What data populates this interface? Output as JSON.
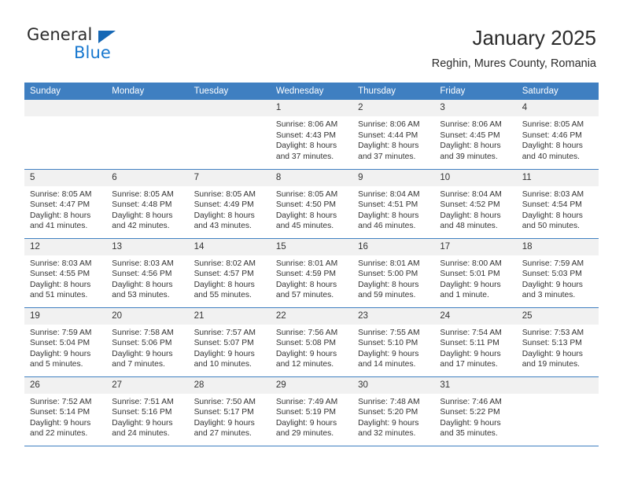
{
  "brand": {
    "name_top": "General",
    "name_bottom": "Blue",
    "accent_color": "#1878cf",
    "triangle_color": "#1567b5"
  },
  "header": {
    "title": "January 2025",
    "subtitle": "Reghin, Mures County, Romania"
  },
  "theme": {
    "header_row_bg": "#3f7fc1",
    "header_row_text": "#ffffff",
    "daynum_bg": "#f1f1f1",
    "grid_line": "#3f7fc1",
    "body_text": "#333333"
  },
  "weekdays": [
    "Sunday",
    "Monday",
    "Tuesday",
    "Wednesday",
    "Thursday",
    "Friday",
    "Saturday"
  ],
  "labels": {
    "sunrise_prefix": "Sunrise:",
    "sunset_prefix": "Sunset:",
    "daylight_prefix": "Daylight:"
  },
  "weeks": [
    [
      {
        "day": "",
        "blank": true,
        "l1": "",
        "l2": "",
        "l3": "",
        "l4": ""
      },
      {
        "day": "",
        "blank": true,
        "l1": "",
        "l2": "",
        "l3": "",
        "l4": ""
      },
      {
        "day": "",
        "blank": true,
        "l1": "",
        "l2": "",
        "l3": "",
        "l4": ""
      },
      {
        "day": "1",
        "blank": false,
        "l1": "Sunrise: 8:06 AM",
        "l2": "Sunset: 4:43 PM",
        "l3": "Daylight: 8 hours",
        "l4": "and 37 minutes."
      },
      {
        "day": "2",
        "blank": false,
        "l1": "Sunrise: 8:06 AM",
        "l2": "Sunset: 4:44 PM",
        "l3": "Daylight: 8 hours",
        "l4": "and 37 minutes."
      },
      {
        "day": "3",
        "blank": false,
        "l1": "Sunrise: 8:06 AM",
        "l2": "Sunset: 4:45 PM",
        "l3": "Daylight: 8 hours",
        "l4": "and 39 minutes."
      },
      {
        "day": "4",
        "blank": false,
        "l1": "Sunrise: 8:05 AM",
        "l2": "Sunset: 4:46 PM",
        "l3": "Daylight: 8 hours",
        "l4": "and 40 minutes."
      }
    ],
    [
      {
        "day": "5",
        "blank": false,
        "l1": "Sunrise: 8:05 AM",
        "l2": "Sunset: 4:47 PM",
        "l3": "Daylight: 8 hours",
        "l4": "and 41 minutes."
      },
      {
        "day": "6",
        "blank": false,
        "l1": "Sunrise: 8:05 AM",
        "l2": "Sunset: 4:48 PM",
        "l3": "Daylight: 8 hours",
        "l4": "and 42 minutes."
      },
      {
        "day": "7",
        "blank": false,
        "l1": "Sunrise: 8:05 AM",
        "l2": "Sunset: 4:49 PM",
        "l3": "Daylight: 8 hours",
        "l4": "and 43 minutes."
      },
      {
        "day": "8",
        "blank": false,
        "l1": "Sunrise: 8:05 AM",
        "l2": "Sunset: 4:50 PM",
        "l3": "Daylight: 8 hours",
        "l4": "and 45 minutes."
      },
      {
        "day": "9",
        "blank": false,
        "l1": "Sunrise: 8:04 AM",
        "l2": "Sunset: 4:51 PM",
        "l3": "Daylight: 8 hours",
        "l4": "and 46 minutes."
      },
      {
        "day": "10",
        "blank": false,
        "l1": "Sunrise: 8:04 AM",
        "l2": "Sunset: 4:52 PM",
        "l3": "Daylight: 8 hours",
        "l4": "and 48 minutes."
      },
      {
        "day": "11",
        "blank": false,
        "l1": "Sunrise: 8:03 AM",
        "l2": "Sunset: 4:54 PM",
        "l3": "Daylight: 8 hours",
        "l4": "and 50 minutes."
      }
    ],
    [
      {
        "day": "12",
        "blank": false,
        "l1": "Sunrise: 8:03 AM",
        "l2": "Sunset: 4:55 PM",
        "l3": "Daylight: 8 hours",
        "l4": "and 51 minutes."
      },
      {
        "day": "13",
        "blank": false,
        "l1": "Sunrise: 8:03 AM",
        "l2": "Sunset: 4:56 PM",
        "l3": "Daylight: 8 hours",
        "l4": "and 53 minutes."
      },
      {
        "day": "14",
        "blank": false,
        "l1": "Sunrise: 8:02 AM",
        "l2": "Sunset: 4:57 PM",
        "l3": "Daylight: 8 hours",
        "l4": "and 55 minutes."
      },
      {
        "day": "15",
        "blank": false,
        "l1": "Sunrise: 8:01 AM",
        "l2": "Sunset: 4:59 PM",
        "l3": "Daylight: 8 hours",
        "l4": "and 57 minutes."
      },
      {
        "day": "16",
        "blank": false,
        "l1": "Sunrise: 8:01 AM",
        "l2": "Sunset: 5:00 PM",
        "l3": "Daylight: 8 hours",
        "l4": "and 59 minutes."
      },
      {
        "day": "17",
        "blank": false,
        "l1": "Sunrise: 8:00 AM",
        "l2": "Sunset: 5:01 PM",
        "l3": "Daylight: 9 hours",
        "l4": "and 1 minute."
      },
      {
        "day": "18",
        "blank": false,
        "l1": "Sunrise: 7:59 AM",
        "l2": "Sunset: 5:03 PM",
        "l3": "Daylight: 9 hours",
        "l4": "and 3 minutes."
      }
    ],
    [
      {
        "day": "19",
        "blank": false,
        "l1": "Sunrise: 7:59 AM",
        "l2": "Sunset: 5:04 PM",
        "l3": "Daylight: 9 hours",
        "l4": "and 5 minutes."
      },
      {
        "day": "20",
        "blank": false,
        "l1": "Sunrise: 7:58 AM",
        "l2": "Sunset: 5:06 PM",
        "l3": "Daylight: 9 hours",
        "l4": "and 7 minutes."
      },
      {
        "day": "21",
        "blank": false,
        "l1": "Sunrise: 7:57 AM",
        "l2": "Sunset: 5:07 PM",
        "l3": "Daylight: 9 hours",
        "l4": "and 10 minutes."
      },
      {
        "day": "22",
        "blank": false,
        "l1": "Sunrise: 7:56 AM",
        "l2": "Sunset: 5:08 PM",
        "l3": "Daylight: 9 hours",
        "l4": "and 12 minutes."
      },
      {
        "day": "23",
        "blank": false,
        "l1": "Sunrise: 7:55 AM",
        "l2": "Sunset: 5:10 PM",
        "l3": "Daylight: 9 hours",
        "l4": "and 14 minutes."
      },
      {
        "day": "24",
        "blank": false,
        "l1": "Sunrise: 7:54 AM",
        "l2": "Sunset: 5:11 PM",
        "l3": "Daylight: 9 hours",
        "l4": "and 17 minutes."
      },
      {
        "day": "25",
        "blank": false,
        "l1": "Sunrise: 7:53 AM",
        "l2": "Sunset: 5:13 PM",
        "l3": "Daylight: 9 hours",
        "l4": "and 19 minutes."
      }
    ],
    [
      {
        "day": "26",
        "blank": false,
        "l1": "Sunrise: 7:52 AM",
        "l2": "Sunset: 5:14 PM",
        "l3": "Daylight: 9 hours",
        "l4": "and 22 minutes."
      },
      {
        "day": "27",
        "blank": false,
        "l1": "Sunrise: 7:51 AM",
        "l2": "Sunset: 5:16 PM",
        "l3": "Daylight: 9 hours",
        "l4": "and 24 minutes."
      },
      {
        "day": "28",
        "blank": false,
        "l1": "Sunrise: 7:50 AM",
        "l2": "Sunset: 5:17 PM",
        "l3": "Daylight: 9 hours",
        "l4": "and 27 minutes."
      },
      {
        "day": "29",
        "blank": false,
        "l1": "Sunrise: 7:49 AM",
        "l2": "Sunset: 5:19 PM",
        "l3": "Daylight: 9 hours",
        "l4": "and 29 minutes."
      },
      {
        "day": "30",
        "blank": false,
        "l1": "Sunrise: 7:48 AM",
        "l2": "Sunset: 5:20 PM",
        "l3": "Daylight: 9 hours",
        "l4": "and 32 minutes."
      },
      {
        "day": "31",
        "blank": false,
        "l1": "Sunrise: 7:46 AM",
        "l2": "Sunset: 5:22 PM",
        "l3": "Daylight: 9 hours",
        "l4": "and 35 minutes."
      },
      {
        "day": "",
        "blank": true,
        "l1": "",
        "l2": "",
        "l3": "",
        "l4": ""
      }
    ]
  ]
}
